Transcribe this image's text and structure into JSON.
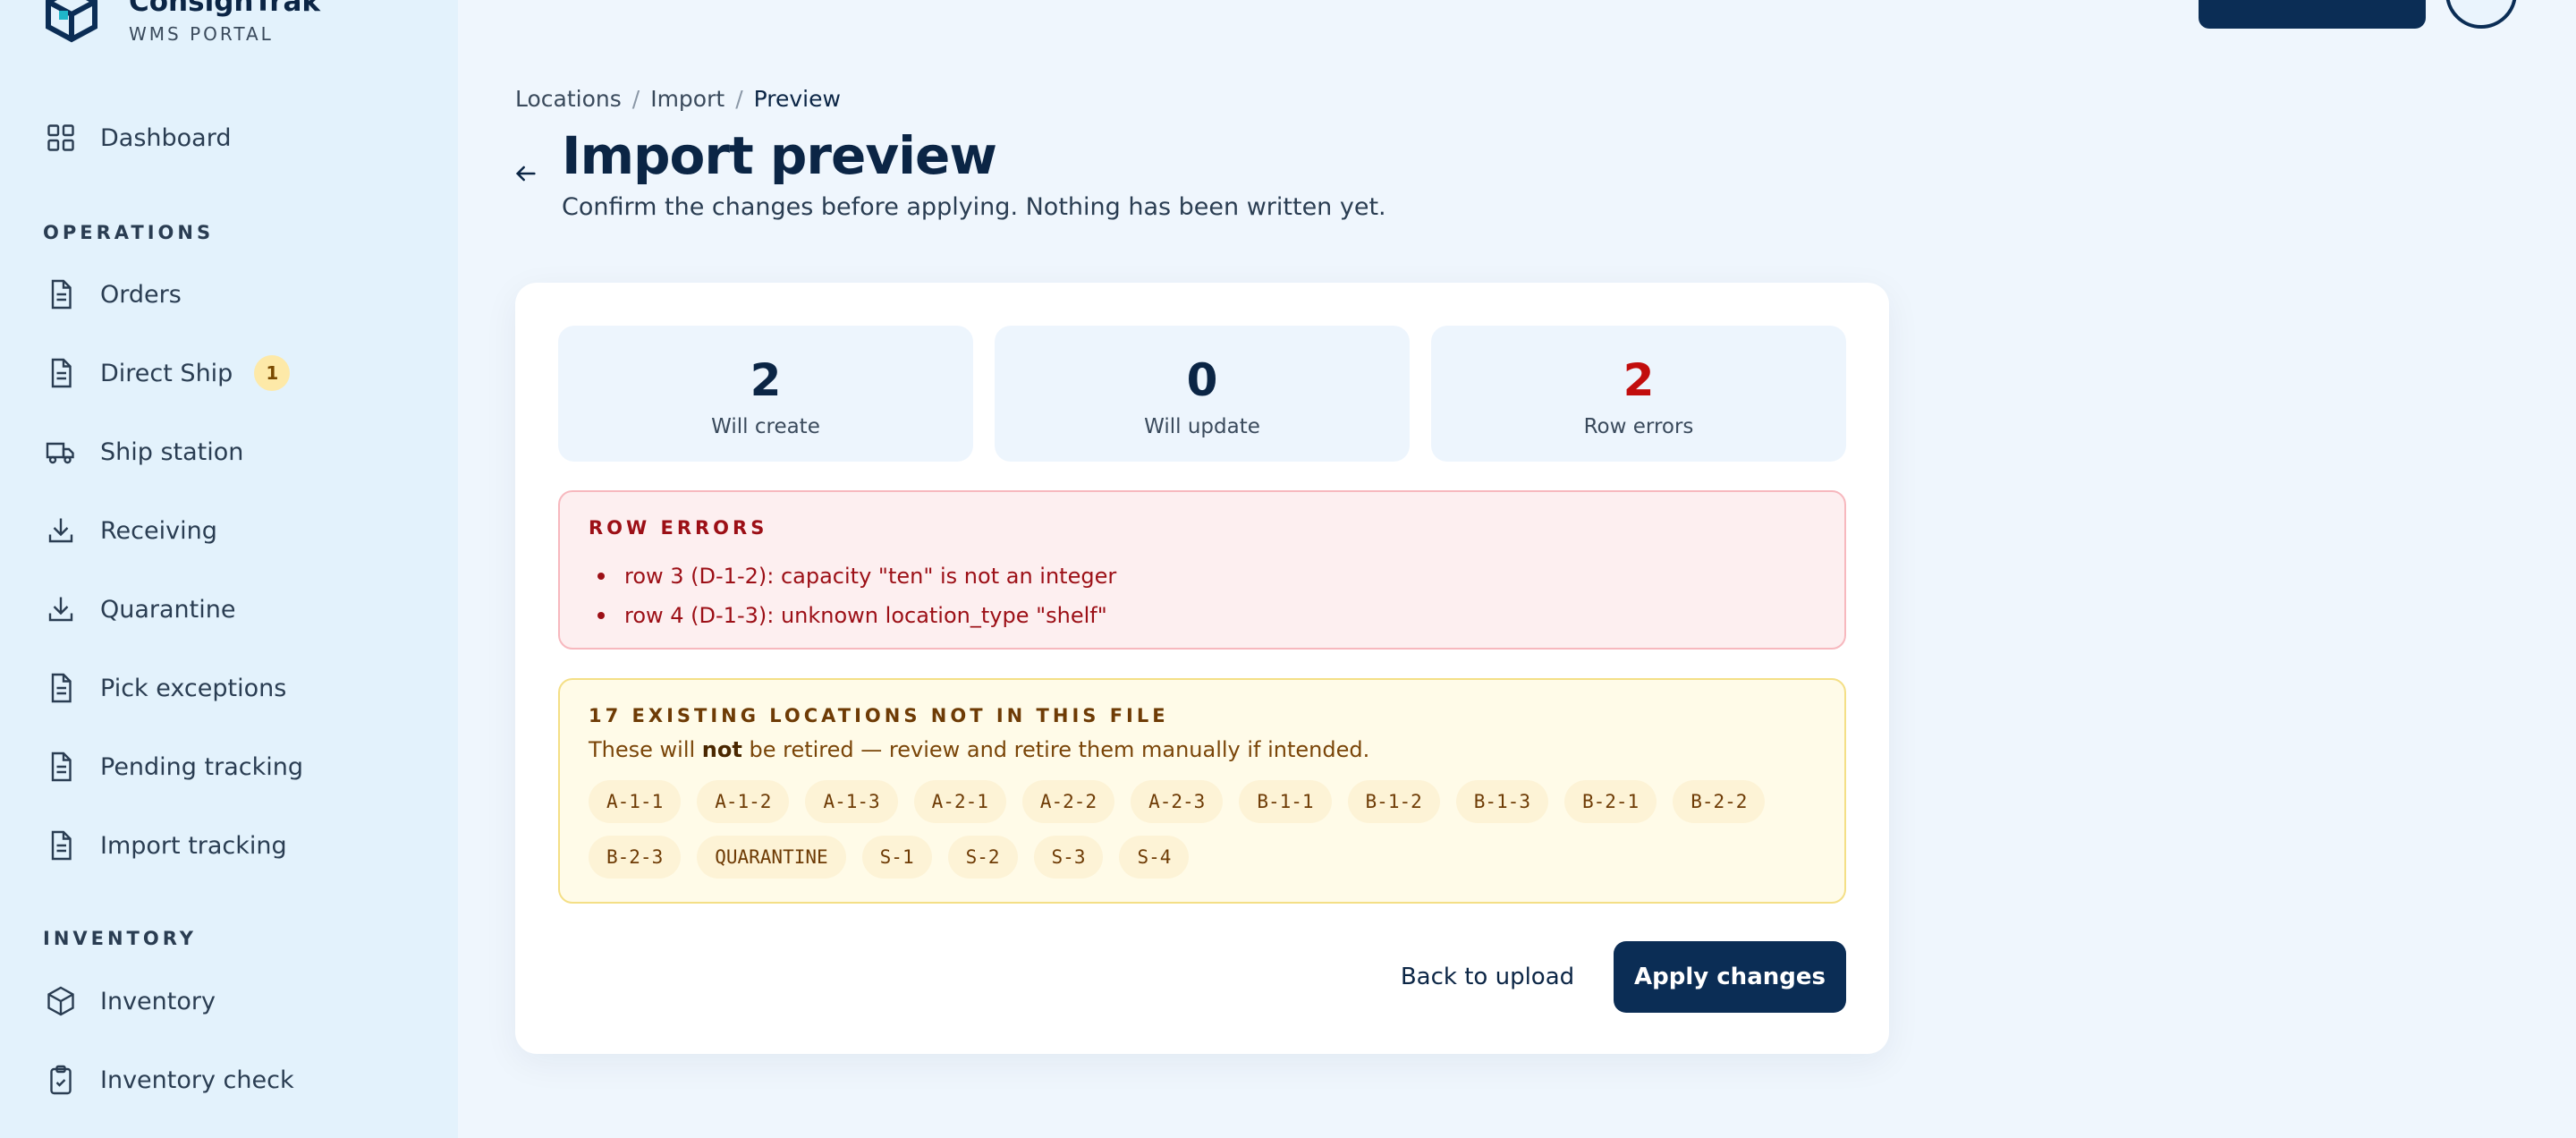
{
  "brand": {
    "name": "ConsignTrak",
    "subtitle": "WMS PORTAL"
  },
  "sidebar": {
    "dashboard": "Dashboard",
    "operations_label": "OPERATIONS",
    "operations": [
      {
        "label": "Orders",
        "icon": "document-icon"
      },
      {
        "label": "Direct Ship",
        "icon": "document-icon",
        "badge": "1"
      },
      {
        "label": "Ship station",
        "icon": "truck-icon"
      },
      {
        "label": "Receiving",
        "icon": "download-icon"
      },
      {
        "label": "Quarantine",
        "icon": "download-icon"
      },
      {
        "label": "Pick exceptions",
        "icon": "document-icon"
      },
      {
        "label": "Pending tracking",
        "icon": "document-icon"
      },
      {
        "label": "Import tracking",
        "icon": "document-icon"
      }
    ],
    "inventory_label": "INVENTORY",
    "inventory": [
      {
        "label": "Inventory",
        "icon": "box-icon"
      },
      {
        "label": "Inventory check",
        "icon": "clipboard-check-icon"
      }
    ]
  },
  "breadcrumb": [
    "Locations",
    "Import",
    "Preview"
  ],
  "page": {
    "title": "Import preview",
    "subtitle": "Confirm the changes before applying. Nothing has been written yet."
  },
  "stats": [
    {
      "value": "2",
      "label": "Will create"
    },
    {
      "value": "0",
      "label": "Will update"
    },
    {
      "value": "2",
      "label": "Row errors"
    }
  ],
  "row_errors": {
    "heading": "ROW ERRORS",
    "items": [
      "row 3 (D-1-2): capacity \"ten\" is not an integer",
      "row 4 (D-1-3): unknown location_type \"shelf\""
    ]
  },
  "existing": {
    "heading": "17 EXISTING LOCATIONS NOT IN THIS FILE",
    "desc_before": "These will ",
    "desc_bold": "not",
    "desc_after": " be retired — review and retire them manually if intended.",
    "codes": [
      "A-1-1",
      "A-1-2",
      "A-1-3",
      "A-2-1",
      "A-2-2",
      "A-2-3",
      "B-1-1",
      "B-1-2",
      "B-1-3",
      "B-2-1",
      "B-2-2",
      "B-2-3",
      "QUARANTINE",
      "S-1",
      "S-2",
      "S-3",
      "S-4"
    ]
  },
  "actions": {
    "back": "Back to upload",
    "apply": "Apply changes"
  },
  "colors": {
    "navy": "#0b2d55",
    "error_red": "#c20d0d",
    "warn_bg": "#fffbe8",
    "error_bg": "#fdeff0",
    "sidebar_bg": "#e3f2fc"
  }
}
